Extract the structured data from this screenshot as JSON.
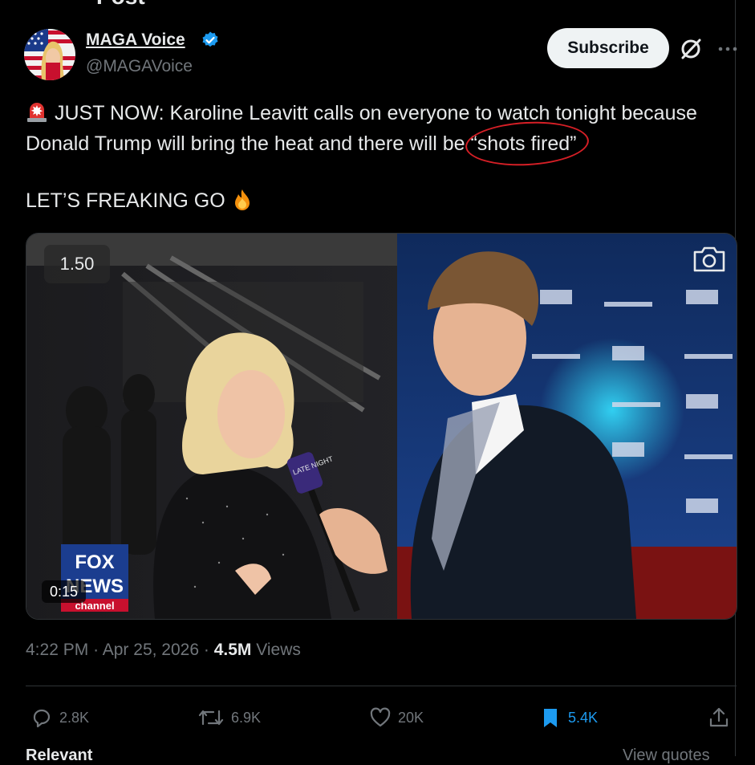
{
  "header": {
    "title": "Post"
  },
  "author": {
    "name": "MAGA Voice",
    "handle": "@MAGAVoice",
    "verified": true
  },
  "actions_top": {
    "subscribe_label": "Subscribe"
  },
  "tweet": {
    "line_a": "JUST NOW: Karoline Leavitt calls on everyone to watch tonight because Donald Trump will bring the heat and there will be ",
    "highlight": "“shots fired”",
    "line_b": "LET’S FREAKING GO"
  },
  "video": {
    "speed": "1.50",
    "elapsed": "0:15",
    "channel_logo_top": "FOX",
    "channel_logo_mid": "NEWS",
    "channel_logo_bottom": "channel",
    "mic_flag": "LATE NIGHT"
  },
  "meta": {
    "time": "4:22 PM",
    "date": "Apr 25, 2026",
    "separator": "·",
    "views_count": "4.5M",
    "views_label": "Views"
  },
  "stats": {
    "replies": "2.8K",
    "reposts": "6.9K",
    "likes": "20K",
    "bookmarks": "5.4K"
  },
  "footer": {
    "relevant": "Relevant",
    "view_quotes": "View quotes"
  },
  "colors": {
    "background": "#000000",
    "text": "#e7e9ea",
    "muted": "#71767b",
    "accent": "#1d9bf0",
    "annotation": "#d61f26"
  }
}
